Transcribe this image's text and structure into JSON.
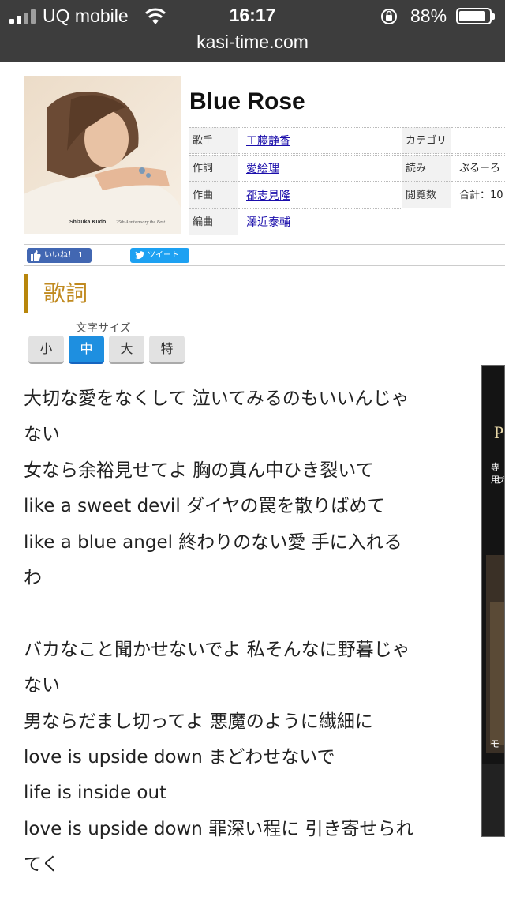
{
  "status_bar": {
    "carrier": "UQ mobile",
    "time": "16:17",
    "battery_percent": "88%",
    "battery_level": 0.88
  },
  "url_bar": {
    "url": "kasi-time.com"
  },
  "song": {
    "title": "Blue Rose",
    "cover_caption": "Shizuka Kudo",
    "cover_caption_script": "25th Anniversary the Best",
    "info": [
      {
        "label": "歌手",
        "value": "工藤静香",
        "link": true
      },
      {
        "label": "作詞",
        "value": "愛絵理",
        "link": true
      },
      {
        "label": "作曲",
        "value": "都志見隆",
        "link": true
      },
      {
        "label": "編曲",
        "value": "澤近泰輔",
        "link": true
      }
    ],
    "info_right": [
      {
        "label": "カテゴリ",
        "value": ""
      },
      {
        "label": "読み",
        "value": "ぶるーろ"
      },
      {
        "label": "閲覧数",
        "value": "合計：10"
      }
    ]
  },
  "social": {
    "like_label": "いいね！ 1",
    "tweet_label": "ツイート"
  },
  "lyrics_section": {
    "heading": "歌詞",
    "font_size_label": "文字サイズ",
    "font_size_options": [
      "小",
      "中",
      "大",
      "特"
    ],
    "font_size_selected": "中"
  },
  "lyrics": [
    "大切な愛をなくして 泣いてみるのもいいんじゃ",
    "ない",
    "女なら余裕見せてよ 胸の真ん中ひき裂いて",
    "like a sweet devil ダイヤの罠を散りばめて",
    "like a blue angel 終わりのない愛 手に入れる",
    "わ",
    "",
    "バカなこと聞かせないでよ 私そんなに野暮じゃ",
    "ない",
    "男ならだまし切ってよ 悪魔のように繊細に",
    "love is upside down まどわせないで",
    "life is inside out",
    "love is upside down 罪深い程に 引き寄せられ",
    "てく"
  ],
  "ad": {
    "brand_initial": "P",
    "line1": "専用",
    "line2": "プ",
    "line3": "モ"
  }
}
